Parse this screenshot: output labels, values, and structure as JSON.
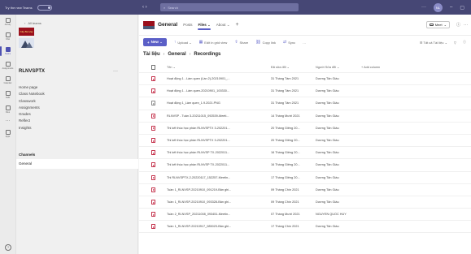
{
  "titlebar": {
    "title": "Try the new Teams",
    "search_placeholder": "Search",
    "avatar": "NL"
  },
  "rail": [
    {
      "label": "Activity",
      "name": "activity"
    },
    {
      "label": "Chat",
      "name": "chat"
    },
    {
      "label": "Teams",
      "name": "teams",
      "active": true
    },
    {
      "label": "Assignments",
      "name": "assignments"
    },
    {
      "label": "Calendar",
      "name": "calendar"
    },
    {
      "label": "Calls",
      "name": "calls"
    },
    {
      "label": "Files",
      "name": "files"
    }
  ],
  "rail_apps_label": "Apps",
  "team": {
    "all_teams": "All teams",
    "logo_text": "Cây Ba Hay",
    "name": "RLNVSPTX",
    "nav": [
      "Home page",
      "Class Notebook",
      "Classwork",
      "Assignments",
      "Grades",
      "Reflect",
      "Insights"
    ],
    "channels_header": "Channels",
    "channel": "General"
  },
  "channel_header": {
    "name": "General",
    "tabs": [
      {
        "label": "Posts"
      },
      {
        "label": "Files ⌄",
        "active": true
      },
      {
        "label": "About ⌄"
      }
    ],
    "meet_label": "Meet"
  },
  "commands": {
    "new": "New ⌄",
    "items": [
      {
        "label": "Upload ⌄",
        "icon": "↑"
      },
      {
        "label": "Edit in grid view",
        "icon": "▦"
      },
      {
        "label": "Share",
        "icon": "⇪"
      },
      {
        "label": "Copy link",
        "icon": "⛓"
      },
      {
        "label": "Sync",
        "icon": "⇄"
      },
      {
        "label": "…",
        "icon": ""
      }
    ],
    "right": [
      "☰ Tất cả Tài liệu ⌄",
      "▽",
      "ⓘ"
    ]
  },
  "breadcrumb": [
    "Tài liệu",
    "General",
    "Recordings"
  ],
  "columns": {
    "name": "Tên ⌄",
    "date": "Đã sửa đổi ⌄",
    "by": "Người Sửa đổi ⌄",
    "add": "+ Add column"
  },
  "files": [
    {
      "name": "Hoạt động 1 - Làm quen (Lần 2)-20210901_...",
      "date": "31 Tháng Tám 2021",
      "by": "Dương Tân Giàu",
      "type": "video"
    },
    {
      "name": "Hoạt động 1 - Làm quen-20210901_100330...",
      "date": "31 Tháng Tám 2021",
      "by": "Dương Tân Giàu",
      "type": "video"
    },
    {
      "name": "Hoạt động 1_Làm quen_1.9.2021.PNG",
      "date": "31 Tháng Tám 2021",
      "by": "Dương Tân Giàu",
      "type": "image"
    },
    {
      "name": "RLNVSP - Tuần 3-20211015_092539-Meeti...",
      "date": "14 Tháng Mười 2021",
      "by": "Dương Tân Giàu",
      "type": "video"
    },
    {
      "name": "Thi kết thúc học phần RLNVSPTX 3-202201...",
      "date": "20 Tháng Giêng 20...",
      "by": "Dương Tân Giàu",
      "type": "video"
    },
    {
      "name": "Thi kết thúc học phần RLNVSPTX 3-202201...",
      "date": "20 Tháng Giêng 20...",
      "by": "Dương Tân Giàu",
      "type": "video"
    },
    {
      "name": "Thi kết thúc học phần RLNVSP TX-2022011...",
      "date": "16 Tháng Giêng 20...",
      "by": "Dương Tân Giàu",
      "type": "video"
    },
    {
      "name": "Thi kết thúc học phần RLNVSP TX-2022011...",
      "date": "16 Tháng Giêng 20...",
      "by": "Dương Tân Giàu",
      "type": "video"
    },
    {
      "name": "Thi RLNVSPTX-2-20220117_152257-Meetin...",
      "date": "17 Tháng Giêng 20...",
      "by": "Dương Tân Giàu",
      "type": "video"
    },
    {
      "name": "Tuần 1_RLNVSP-20210910_091219-Bản ghi...",
      "date": "09 Tháng Chín 2021",
      "by": "Dương Tân Giàu",
      "type": "video"
    },
    {
      "name": "Tuần 1_RLNVSP-20210910_093328-Bản ghi...",
      "date": "09 Tháng Chín 2021",
      "by": "Dương Tân Giàu",
      "type": "video"
    },
    {
      "name": "Tuần 2_RLNVSP_20211008_093451-Meetin...",
      "date": "07 Tháng Mười 2021",
      "by": "NGUYỄN QUỐC HUY",
      "type": "video"
    },
    {
      "name": "Tuần 1_RLNVSP-20210917_085023-Bản ghi...",
      "date": "17 Tháng Chín 2021",
      "by": "Dương Tân Giàu",
      "type": "video"
    }
  ]
}
